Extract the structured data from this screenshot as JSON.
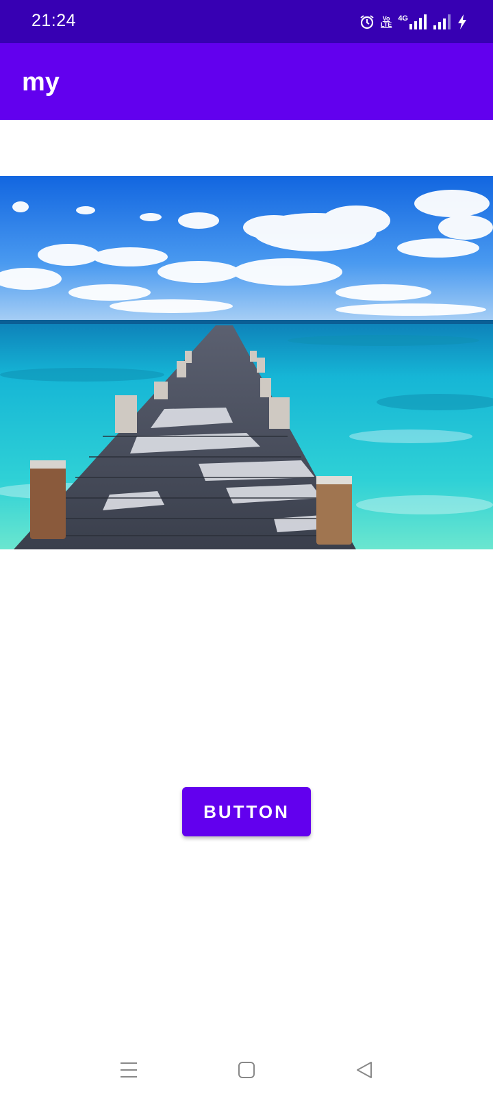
{
  "status_bar": {
    "time": "21:24",
    "icons": [
      "alarm-icon",
      "volte-icon",
      "4g-signal-icon",
      "signal-icon",
      "charging-icon"
    ],
    "volte_top": "Vo",
    "volte_bottom": "LTE",
    "network_label": "4G"
  },
  "app_bar": {
    "title": "my",
    "color": "#6200ee"
  },
  "hero_image": {
    "description_icon": "pier-ocean-photo"
  },
  "main_button": {
    "label": "BUTTON",
    "color": "#6200ee"
  },
  "nav_bar": {
    "items": [
      "menu-icon",
      "home-icon",
      "back-icon"
    ]
  },
  "colors": {
    "status_bar": "#3700b3",
    "accent": "#6200ee",
    "background": "#ffffff"
  }
}
